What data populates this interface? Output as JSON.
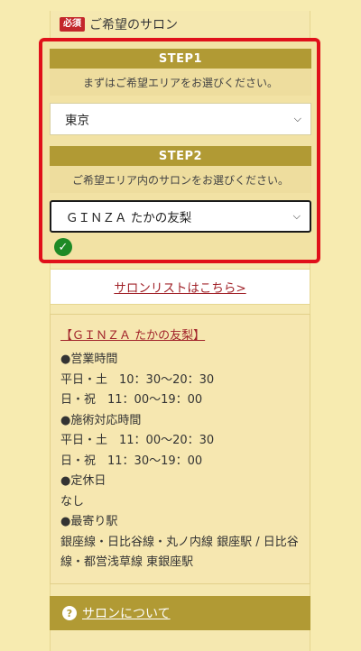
{
  "section": {
    "badge": "必須",
    "title": "ご希望のサロン"
  },
  "step1": {
    "header": "STEP1",
    "desc": "まずはご希望エリアをお選びください。",
    "selected": "東京"
  },
  "step2": {
    "header": "STEP2",
    "desc": "ご希望エリア内のサロンをお選びください。",
    "selected": "ＧＩＮＺＡ たかの友梨"
  },
  "salon_list_link": "サロンリストはこちら>",
  "info": {
    "salon_name": "【ＧＩＮＺＡ たかの友梨】",
    "lines": [
      "●営業時間",
      "平日・土　10：30〜20：30",
      "日・祝　11：00〜19：00",
      "●施術対応時間",
      "平日・土　11：00〜20：30",
      "日・祝　11：30〜19：00",
      "●定休日",
      "なし",
      "●最寄り駅",
      "銀座線・日比谷線・丸ノ内線 銀座駅 / 日比谷線・都営浅草線 東銀座駅"
    ]
  },
  "about": {
    "label": "サロンについて",
    "icon": "question-icon"
  },
  "colors": {
    "accent": "#b19a34",
    "highlight_border": "#e0101a",
    "link": "#a1232a",
    "check": "#1e8a26"
  }
}
